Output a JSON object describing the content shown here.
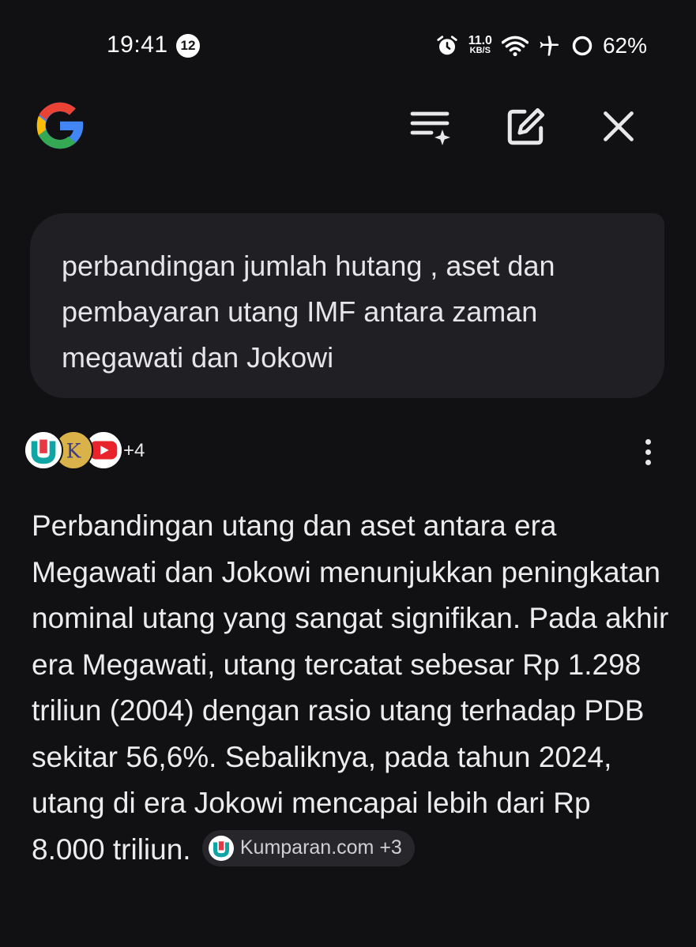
{
  "status_bar": {
    "time": "19:41",
    "notification_count": "12",
    "net_speed_value": "11.0",
    "net_speed_unit": "KB/S",
    "battery": "62%"
  },
  "header": {
    "icons": [
      "google-logo",
      "history-icon",
      "edit-icon",
      "close-icon"
    ]
  },
  "query": {
    "text": "perbandingan jumlah hutang , aset dan pembayaran utang IMF antara zaman megawati dan Jokowi"
  },
  "sources": {
    "more_count": "+4"
  },
  "answer": {
    "text": "Perbandingan utang dan aset antara era Megawati dan Jokowi menunjukkan peningkatan nominal utang yang sangat signifikan. Pada akhir era Megawati, utang tercatat sebesar Rp 1.298 triliun (2004) dengan rasio utang terhadap PDB sekitar 56,6%. Sebaliknya, pada tahun 2024, utang di era Jokowi mencapai lebih dari Rp 8.000 triliun.",
    "citation_label": "Kumparan.com +3"
  },
  "colors": {
    "background": "#111114",
    "bubble": "#1f1f24",
    "chip": "#26262b"
  }
}
